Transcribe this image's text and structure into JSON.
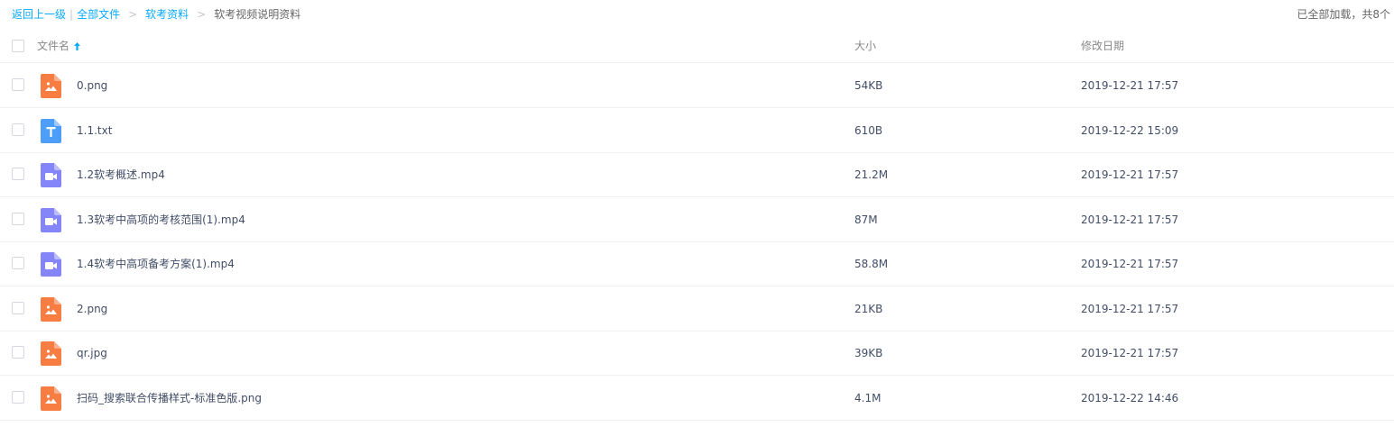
{
  "breadcrumb": {
    "back": "返回上一级",
    "all_files": "全部文件",
    "parent": "软考资料",
    "current": "软考视频说明资料"
  },
  "status": "已全部加载，共8个",
  "columns": {
    "name": "文件名",
    "size": "大小",
    "modified": "修改日期"
  },
  "files": [
    {
      "name": "0.png",
      "size": "54KB",
      "date": "2019-12-21 17:57",
      "type": "image-icon"
    },
    {
      "name": "1.1.txt",
      "size": "610B",
      "date": "2019-12-22 15:09",
      "type": "text-file-icon"
    },
    {
      "name": "1.2软考概述.mp4",
      "size": "21.2M",
      "date": "2019-12-21 17:57",
      "type": "video-icon"
    },
    {
      "name": "1.3软考中高项的考核范围(1).mp4",
      "size": "87M",
      "date": "2019-12-21 17:57",
      "type": "video-icon"
    },
    {
      "name": "1.4软考中高项备考方案(1).mp4",
      "size": "58.8M",
      "date": "2019-12-21 17:57",
      "type": "video-icon"
    },
    {
      "name": "2.png",
      "size": "21KB",
      "date": "2019-12-21 17:57",
      "type": "image-icon"
    },
    {
      "name": "qr.jpg",
      "size": "39KB",
      "date": "2019-12-21 17:57",
      "type": "image-icon"
    },
    {
      "name": "扫码_搜索联合传播样式-标准色版.png",
      "size": "4.1M",
      "date": "2019-12-22 14:46",
      "type": "image-icon"
    }
  ],
  "colors": {
    "link": "#09aaff",
    "image": "#f77d42",
    "text": "#4d9ef8",
    "video": "#8485f9"
  }
}
